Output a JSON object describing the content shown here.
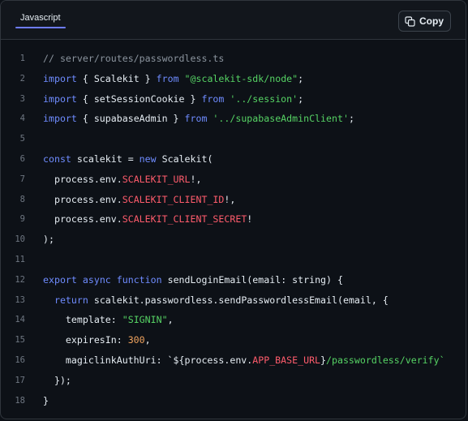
{
  "tab": {
    "label": "Javascript"
  },
  "copy_button": {
    "label": "Copy",
    "icon": "copy-icon"
  },
  "colors": {
    "background": "#0d1117",
    "tab_underline": "#6e7cff",
    "keyword": "#6f8cff",
    "string": "#56d364",
    "constant": "#ff5c6c",
    "number": "#f0a35e",
    "comment": "#8b949e",
    "line_number": "#6e7681"
  },
  "code_lines": [
    {
      "n": "1",
      "tokens": [
        {
          "t": "// server/routes/passwordless.ts",
          "c": "cm"
        }
      ]
    },
    {
      "n": "2",
      "tokens": [
        {
          "t": "import",
          "c": "kw"
        },
        {
          "t": " { Scalekit } ",
          "c": ""
        },
        {
          "t": "from",
          "c": "kw"
        },
        {
          "t": " ",
          "c": ""
        },
        {
          "t": "\"@scalekit-sdk/node\"",
          "c": "st"
        },
        {
          "t": ";",
          "c": ""
        }
      ]
    },
    {
      "n": "3",
      "tokens": [
        {
          "t": "import",
          "c": "kw"
        },
        {
          "t": " { setSessionCookie } ",
          "c": ""
        },
        {
          "t": "from",
          "c": "kw"
        },
        {
          "t": " ",
          "c": ""
        },
        {
          "t": "'../session'",
          "c": "st"
        },
        {
          "t": ";",
          "c": ""
        }
      ]
    },
    {
      "n": "4",
      "tokens": [
        {
          "t": "import",
          "c": "kw"
        },
        {
          "t": " { supabaseAdmin } ",
          "c": ""
        },
        {
          "t": "from",
          "c": "kw"
        },
        {
          "t": " ",
          "c": ""
        },
        {
          "t": "'../supabaseAdminClient'",
          "c": "st"
        },
        {
          "t": ";",
          "c": ""
        }
      ]
    },
    {
      "n": "5",
      "tokens": []
    },
    {
      "n": "6",
      "tokens": [
        {
          "t": "const",
          "c": "kw"
        },
        {
          "t": " scalekit = ",
          "c": ""
        },
        {
          "t": "new",
          "c": "kw"
        },
        {
          "t": " Scalekit(",
          "c": ""
        }
      ]
    },
    {
      "n": "7",
      "tokens": [
        {
          "t": "  process.env.",
          "c": ""
        },
        {
          "t": "SCALEKIT_URL",
          "c": "cn"
        },
        {
          "t": "!,",
          "c": ""
        }
      ]
    },
    {
      "n": "8",
      "tokens": [
        {
          "t": "  process.env.",
          "c": ""
        },
        {
          "t": "SCALEKIT_CLIENT_ID",
          "c": "cn"
        },
        {
          "t": "!,",
          "c": ""
        }
      ]
    },
    {
      "n": "9",
      "tokens": [
        {
          "t": "  process.env.",
          "c": ""
        },
        {
          "t": "SCALEKIT_CLIENT_SECRET",
          "c": "cn"
        },
        {
          "t": "!",
          "c": ""
        }
      ]
    },
    {
      "n": "10",
      "tokens": [
        {
          "t": ");",
          "c": ""
        }
      ]
    },
    {
      "n": "11",
      "tokens": []
    },
    {
      "n": "12",
      "tokens": [
        {
          "t": "export",
          "c": "kw"
        },
        {
          "t": " ",
          "c": ""
        },
        {
          "t": "async",
          "c": "kw"
        },
        {
          "t": " ",
          "c": ""
        },
        {
          "t": "function",
          "c": "kw"
        },
        {
          "t": " sendLoginEmail(email: string) {",
          "c": ""
        }
      ]
    },
    {
      "n": "13",
      "tokens": [
        {
          "t": "  ",
          "c": ""
        },
        {
          "t": "return",
          "c": "kw"
        },
        {
          "t": " scalekit.passwordless.sendPasswordlessEmail(email, {",
          "c": ""
        }
      ]
    },
    {
      "n": "14",
      "tokens": [
        {
          "t": "    template: ",
          "c": ""
        },
        {
          "t": "\"SIGNIN\"",
          "c": "st"
        },
        {
          "t": ",",
          "c": ""
        }
      ]
    },
    {
      "n": "15",
      "tokens": [
        {
          "t": "    expiresIn: ",
          "c": ""
        },
        {
          "t": "300",
          "c": "nu"
        },
        {
          "t": ",",
          "c": ""
        }
      ]
    },
    {
      "n": "16",
      "tokens": [
        {
          "t": "    magiclinkAuthUri: `${process.env.",
          "c": ""
        },
        {
          "t": "APP_BASE_URL",
          "c": "cn"
        },
        {
          "t": "}",
          "c": ""
        },
        {
          "t": "/passwordless/verify`",
          "c": "st"
        }
      ]
    },
    {
      "n": "17",
      "tokens": [
        {
          "t": "  });",
          "c": ""
        }
      ]
    },
    {
      "n": "18",
      "tokens": [
        {
          "t": "}",
          "c": ""
        }
      ]
    }
  ]
}
